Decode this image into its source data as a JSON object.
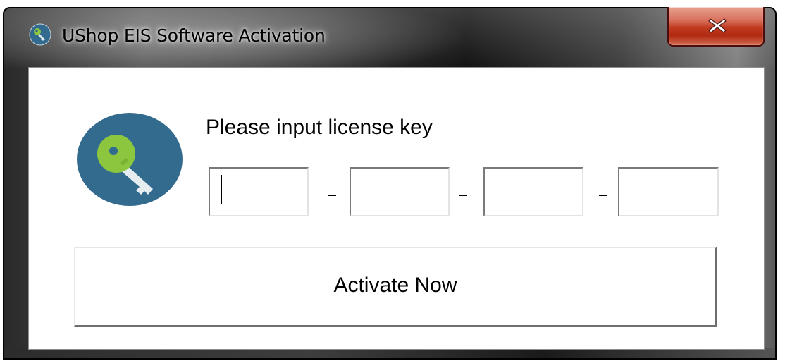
{
  "window": {
    "title": "UShop EIS Software Activation",
    "icon": "key-icon",
    "close_icon": "close-icon",
    "accent_color": "#336b8f",
    "key_color": "#8cc63f"
  },
  "form": {
    "prompt": "Please input license key",
    "separators": [
      "-",
      "-",
      "-"
    ],
    "fields": [
      {
        "value": "",
        "placeholder": ""
      },
      {
        "value": "",
        "placeholder": ""
      },
      {
        "value": "",
        "placeholder": ""
      },
      {
        "value": "",
        "placeholder": ""
      }
    ],
    "activate_label": "Activate Now"
  }
}
